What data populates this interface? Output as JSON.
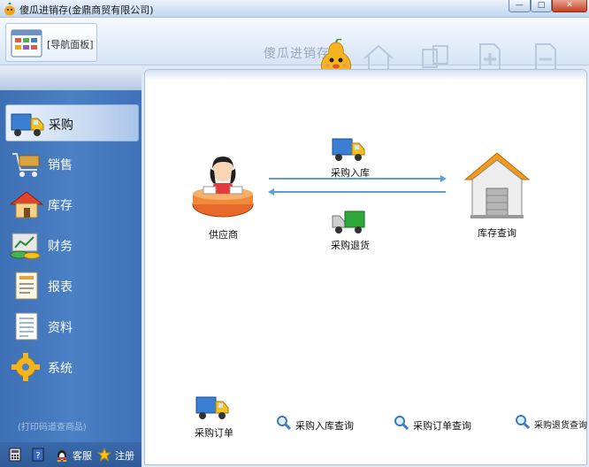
{
  "window": {
    "title": "傻瓜进销存(金鼎商贸有限公司)",
    "controls": {
      "minimize": "—",
      "maximize": "□",
      "close": "✕"
    }
  },
  "toolbar": {
    "nav_panel_label": "[导航面板]",
    "brand": "傻瓜进销存",
    "icons": [
      "home-icon",
      "copy-icon",
      "add-document-icon",
      "remove-document-icon"
    ]
  },
  "sidebar": {
    "items": [
      {
        "label": "采购",
        "icon": "truck-icon",
        "active": true
      },
      {
        "label": "销售",
        "icon": "cart-icon",
        "active": false
      },
      {
        "label": "库存",
        "icon": "house-icon",
        "active": false
      },
      {
        "label": "财务",
        "icon": "money-icon",
        "active": false
      },
      {
        "label": "报表",
        "icon": "report-icon",
        "active": false
      },
      {
        "label": "资料",
        "icon": "document-icon",
        "active": false
      },
      {
        "label": "系统",
        "icon": "gear-icon",
        "active": false
      }
    ],
    "note": "(打印码道查商品)",
    "bottom": {
      "service": "客服",
      "register": "注册"
    }
  },
  "flow": {
    "supplier": "供应商",
    "purchase_in": "采购入库",
    "purchase_return": "采购退货",
    "stock_query": "库存查询"
  },
  "quick_links": {
    "purchase_order": "采购订单",
    "purchase_in_query": "采购入库查询",
    "purchase_order_query": "采购订单查询",
    "purchase_return_query": "采购退货查询"
  },
  "colors": {
    "sidebar_blue": "#4b80c4",
    "flow_arrow": "#5aa0d8",
    "truck_blue": "#3b7fd3",
    "truck_green": "#2fa83a",
    "roof_orange": "#f29a1d"
  }
}
